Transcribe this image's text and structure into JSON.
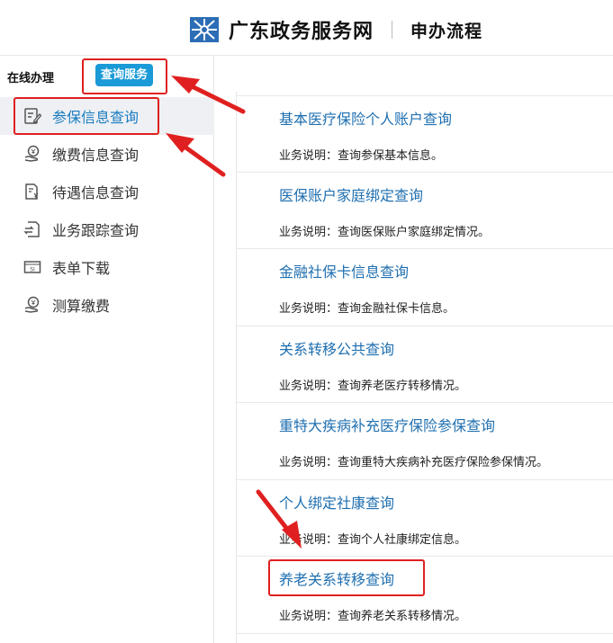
{
  "header": {
    "site_name": "广东政务服务网",
    "sub_title": "申办流程"
  },
  "tabs": {
    "online": "在线办理",
    "query": "查询服务"
  },
  "menu": [
    {
      "label": "参保信息查询",
      "icon": "document-edit-icon"
    },
    {
      "label": "缴费信息查询",
      "icon": "payment-icon"
    },
    {
      "label": "待遇信息查询",
      "icon": "document-yen-icon"
    },
    {
      "label": "业务跟踪查询",
      "icon": "transfer-track-icon"
    },
    {
      "label": "表单下载",
      "icon": "form-download-icon"
    },
    {
      "label": "测算缴费",
      "icon": "calculate-payment-icon"
    }
  ],
  "services": [
    {
      "title": "基本医疗保险个人账户查询",
      "desc": "业务说明：查询参保基本信息。"
    },
    {
      "title": "医保账户家庭绑定查询",
      "desc": "业务说明：查询医保账户家庭绑定情况。"
    },
    {
      "title": "金融社保卡信息查询",
      "desc": "业务说明：查询金融社保卡信息。"
    },
    {
      "title": "关系转移公共查询",
      "desc": "业务说明：查询养老医疗转移情况。"
    },
    {
      "title": "重特大疾病补充医疗保险参保查询",
      "desc": "业务说明：查询重特大疾病补充医疗保险参保情况。"
    },
    {
      "title": "个人绑定社康查询",
      "desc": "业务说明：查询个人社康绑定信息。"
    },
    {
      "title": "养老关系转移查询",
      "desc": "业务说明：查询养老关系转移情况。"
    }
  ],
  "colors": {
    "accent": "#1a9ad6",
    "link": "#1f6fb0",
    "annotation_red": "#e02020"
  }
}
